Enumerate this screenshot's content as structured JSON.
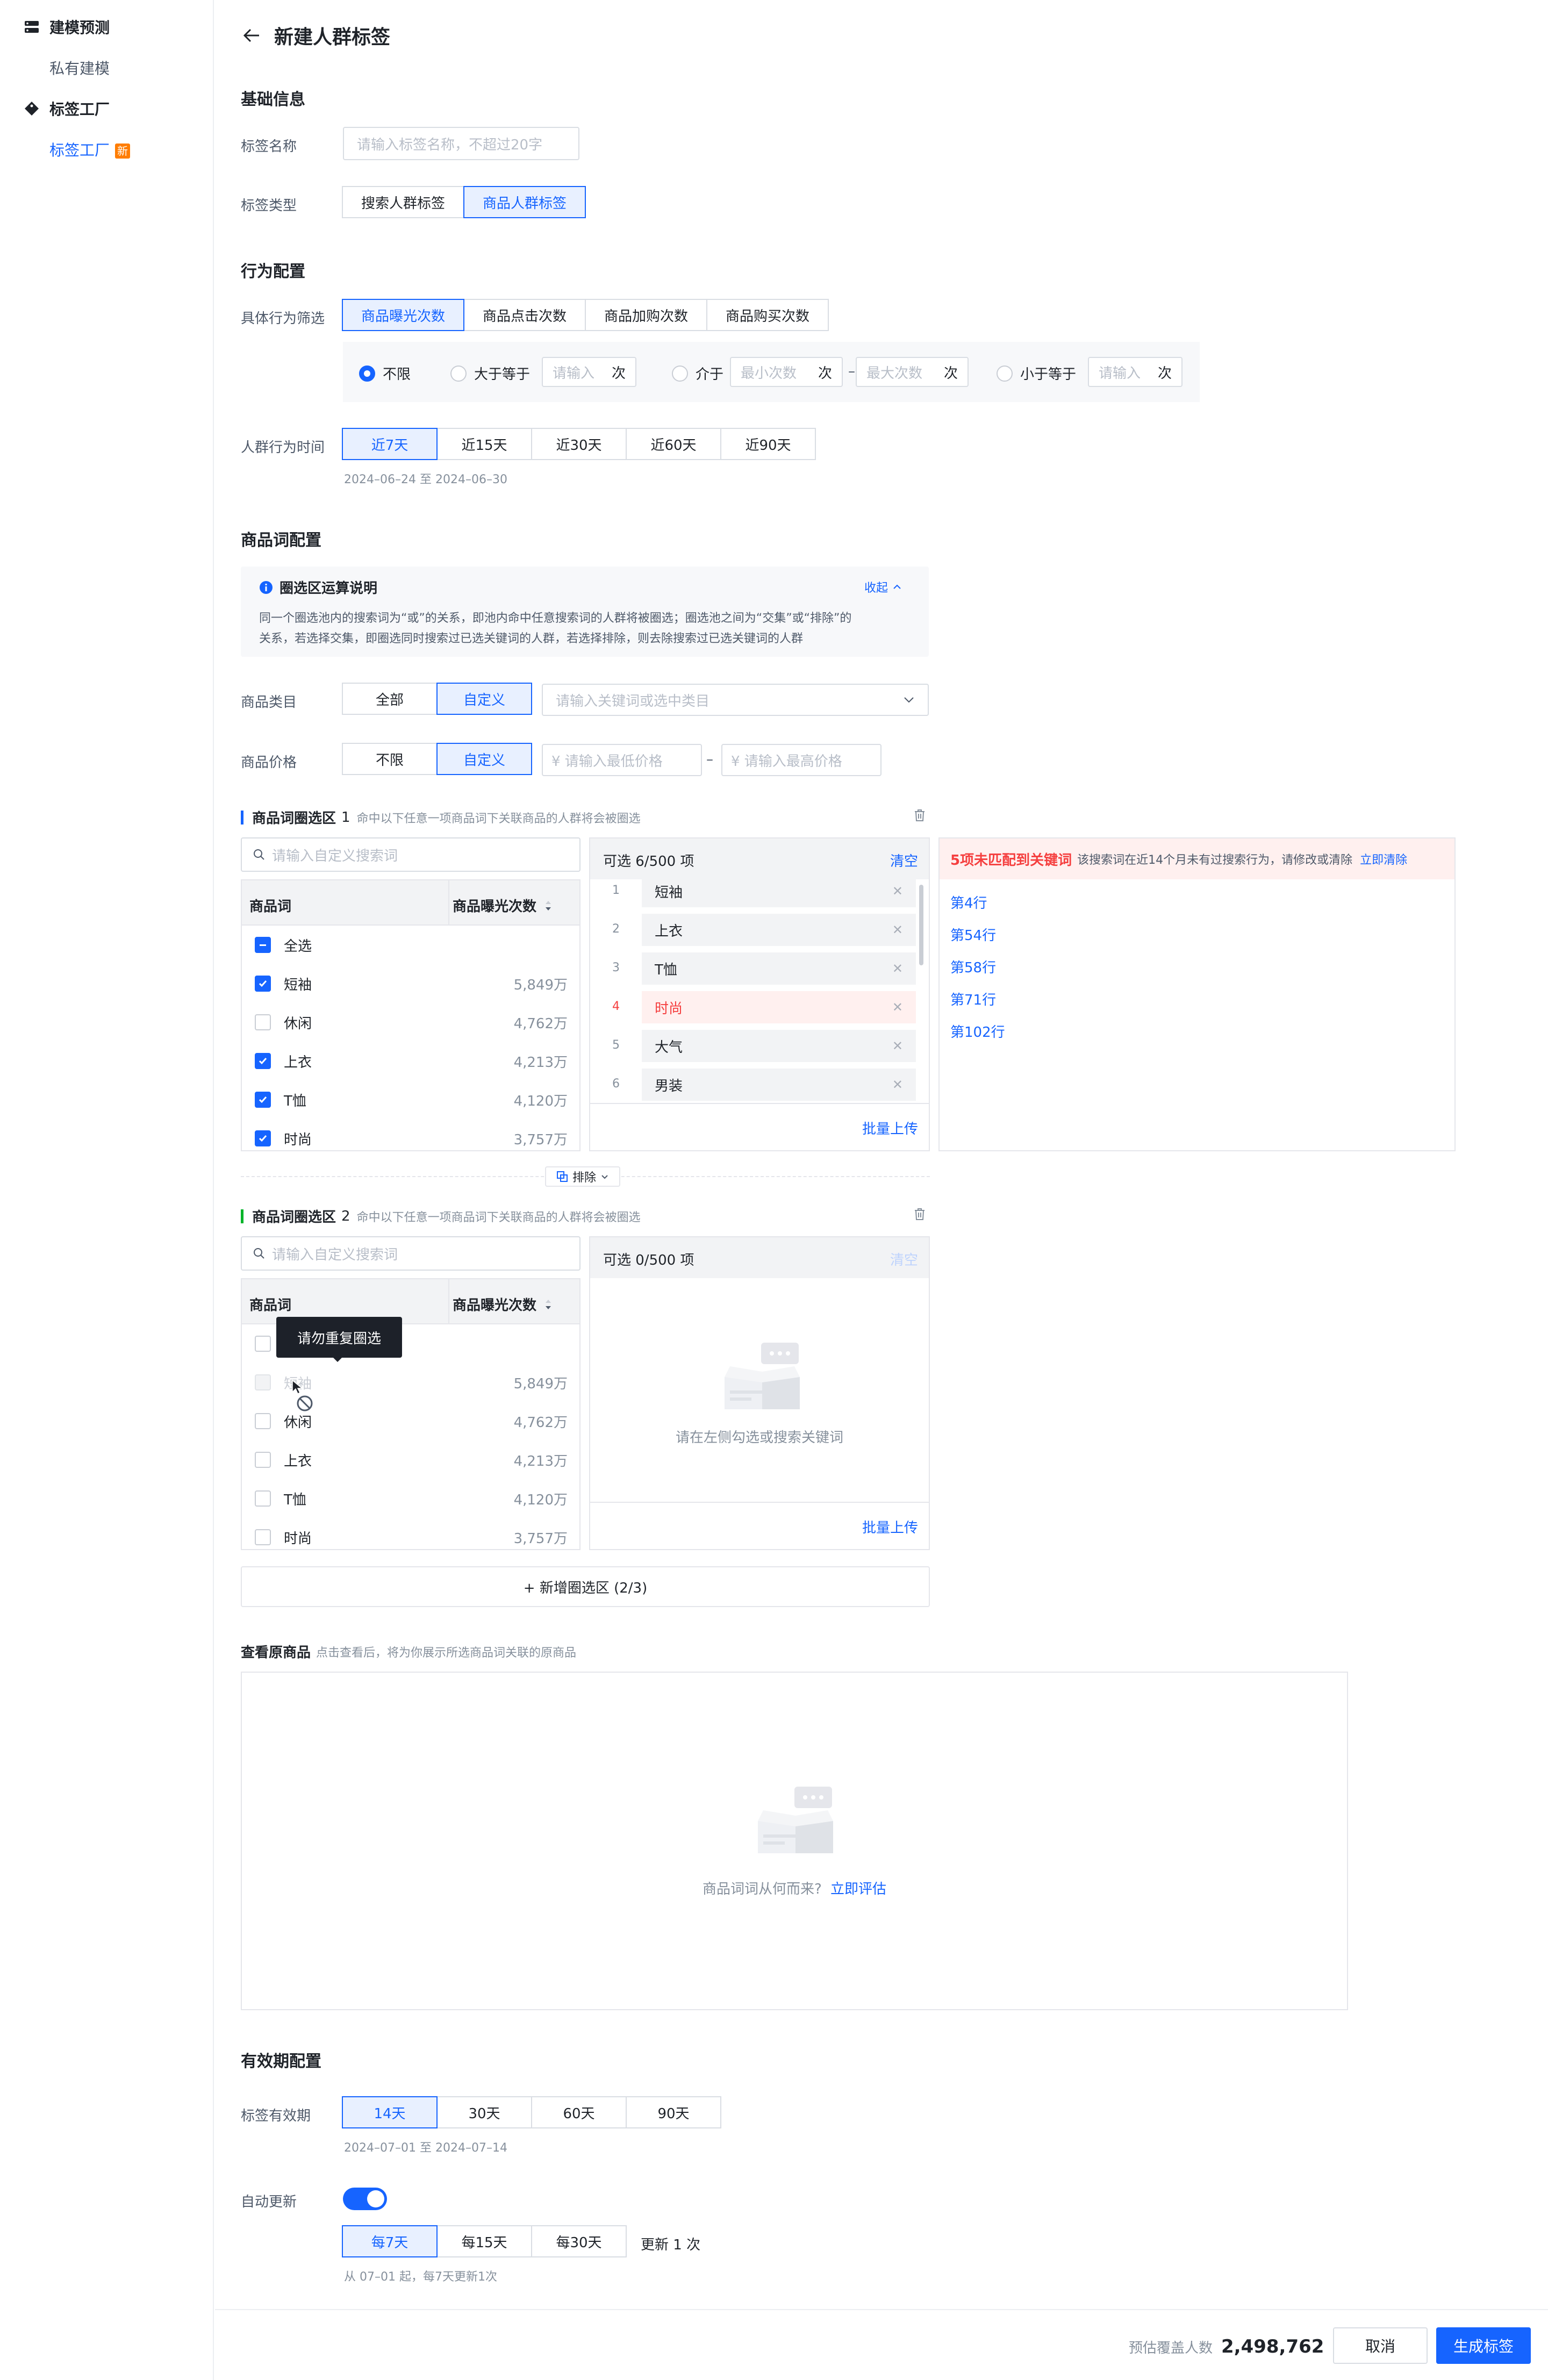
{
  "sidebar": {
    "groups": [
      {
        "label": "建模预测",
        "icon": "server-icon",
        "children": [
          {
            "label": "私有建模"
          }
        ]
      },
      {
        "label": "标签工厂",
        "icon": "tag-icon",
        "children": [
          {
            "label": "标签工厂",
            "badge": "新",
            "active": true
          }
        ]
      }
    ]
  },
  "header": {
    "title": "新建人群标签",
    "back_icon": "arrow-left-icon"
  },
  "basic": {
    "title": "基础信息",
    "name_label": "标签名称",
    "name_placeholder": "请输入标签名称，不超过20字",
    "type_label": "标签类型",
    "type_options": [
      "搜索人群标签",
      "商品人群标签"
    ],
    "type_selected": "商品人群标签"
  },
  "behavior": {
    "title": "行为配置",
    "filter_label": "具体行为筛选",
    "filter_options": [
      "商品曝光次数",
      "商品点击次数",
      "商品加购次数",
      "商品购买次数"
    ],
    "filter_selected": "商品曝光次数",
    "radios": {
      "unlimited": "不限",
      "gte": "大于等于",
      "gte_placeholder": "请输入",
      "unit": "次",
      "between": "介于",
      "min_placeholder": "最小次数",
      "dash": "–",
      "max_placeholder": "最大次数",
      "lte": "小于等于",
      "lte_placeholder": "请输入",
      "selected": "不限"
    },
    "time_label": "人群行为时间",
    "time_options": [
      "近7天",
      "近15天",
      "近30天",
      "近60天",
      "近90天"
    ],
    "time_selected": "近7天",
    "time_range": "2024–06–24 至 2024–06–30"
  },
  "product": {
    "title": "商品词配置",
    "info_title": "圈选区运算说明",
    "info_collapse": "收起",
    "info_text_1": "同一个圈选池内的搜索词为“或”的关系，即池内命中任意搜索词的人群将被圈选；圈选池之间为“交集”或“排除”的",
    "info_text_2": "关系，若选择交集，即圈选同时搜索过已选关键词的人群，若选择排除，则去除搜索过已选关键词的人群",
    "category_label": "商品类目",
    "category_options": [
      "全部",
      "自定义"
    ],
    "category_selected": "自定义",
    "category_placeholder": "请输入关键词或选中类目",
    "price_label": "商品价格",
    "price_options": [
      "不限",
      "自定义"
    ],
    "price_selected": "自定义",
    "price_min_placeholder": "¥ 请输入最低价格",
    "price_dash": "–",
    "price_max_placeholder": "¥ 请输入最高价格"
  },
  "zone1": {
    "title": "商品词圈选区",
    "index": "1",
    "desc": "命中以下任意一项商品词下关联商品的人群将会被圈选",
    "search_placeholder": "请输入自定义搜索词",
    "col_word": "商品词",
    "col_exposure": "商品曝光次数",
    "select_all": "全选",
    "rows": [
      {
        "name": "短袖",
        "value": "5,849万",
        "checked": true
      },
      {
        "name": "休闲",
        "value": "4,762万",
        "checked": false
      },
      {
        "name": "上衣",
        "value": "4,213万",
        "checked": true
      },
      {
        "name": "T恤",
        "value": "4,120万",
        "checked": true
      },
      {
        "name": "时尚",
        "value": "3,757万",
        "checked": true
      }
    ],
    "selected_title": "可选 6/500 项",
    "clear": "清空",
    "selected": [
      {
        "idx": "1",
        "name": "短袖",
        "error": false
      },
      {
        "idx": "2",
        "name": "上衣",
        "error": false
      },
      {
        "idx": "3",
        "name": "T恤",
        "error": false
      },
      {
        "idx": "4",
        "name": "时尚",
        "error": true
      },
      {
        "idx": "5",
        "name": "大气",
        "error": false
      },
      {
        "idx": "6",
        "name": "男装",
        "error": false
      }
    ],
    "batch_upload": "批量上传",
    "error_title": "5项未匹配到关键词",
    "error_desc": "该搜索词在近14个月未有过搜索行为，请修改或清除",
    "error_action": "立即清除",
    "error_rows": [
      "第4行",
      "第54行",
      "第58行",
      "第71行",
      "第102行"
    ]
  },
  "operator": {
    "label": "排除"
  },
  "zone2": {
    "title": "商品词圈选区",
    "index": "2",
    "desc": "命中以下任意一项商品词下关联商品的人群将会被圈选",
    "search_placeholder": "请输入自定义搜索词",
    "col_word": "商品词",
    "col_exposure": "商品曝光次数",
    "tooltip": "请勿重复圈选",
    "rows": [
      {
        "name": "短袖",
        "value": "5,849万",
        "disabled": true
      },
      {
        "name": "休闲",
        "value": "4,762万",
        "disabled": false
      },
      {
        "name": "上衣",
        "value": "4,213万",
        "disabled": false
      },
      {
        "name": "T恤",
        "value": "4,120万",
        "disabled": false
      },
      {
        "name": "时尚",
        "value": "3,757万",
        "disabled": false
      }
    ],
    "selected_title": "可选 0/500 项",
    "clear": "清空",
    "empty_text": "请在左侧勾选或搜索关键词",
    "batch_upload": "批量上传"
  },
  "add_zone": "+ 新增圈选区 (2/3)",
  "view_products": {
    "title": "查看原商品",
    "desc": "点击查看后，将为你展示所选商品词关联的原商品",
    "empty_text": "商品词词从何而来?",
    "empty_link": "立即评估"
  },
  "validity": {
    "title": "有效期配置",
    "period_label": "标签有效期",
    "period_options": [
      "14天",
      "30天",
      "60天",
      "90天"
    ],
    "period_selected": "14天",
    "period_range": "2024–07–01 至 2024–07–14",
    "auto_label": "自动更新",
    "auto_on": true,
    "freq_options": [
      "每7天",
      "每15天",
      "每30天"
    ],
    "freq_selected": "每7天",
    "freq_suffix": "更新 1 次",
    "freq_hint": "从 07–01 起，每7天更新1次"
  },
  "footer": {
    "estimate_label": "预估覆盖人数",
    "estimate_value": "2,498,762",
    "cancel": "取消",
    "submit": "生成标签"
  },
  "colors": {
    "primary": "#1664ff",
    "error": "#f53f3f",
    "badge": "#ff7d00",
    "accent_green": "#00b42a"
  }
}
